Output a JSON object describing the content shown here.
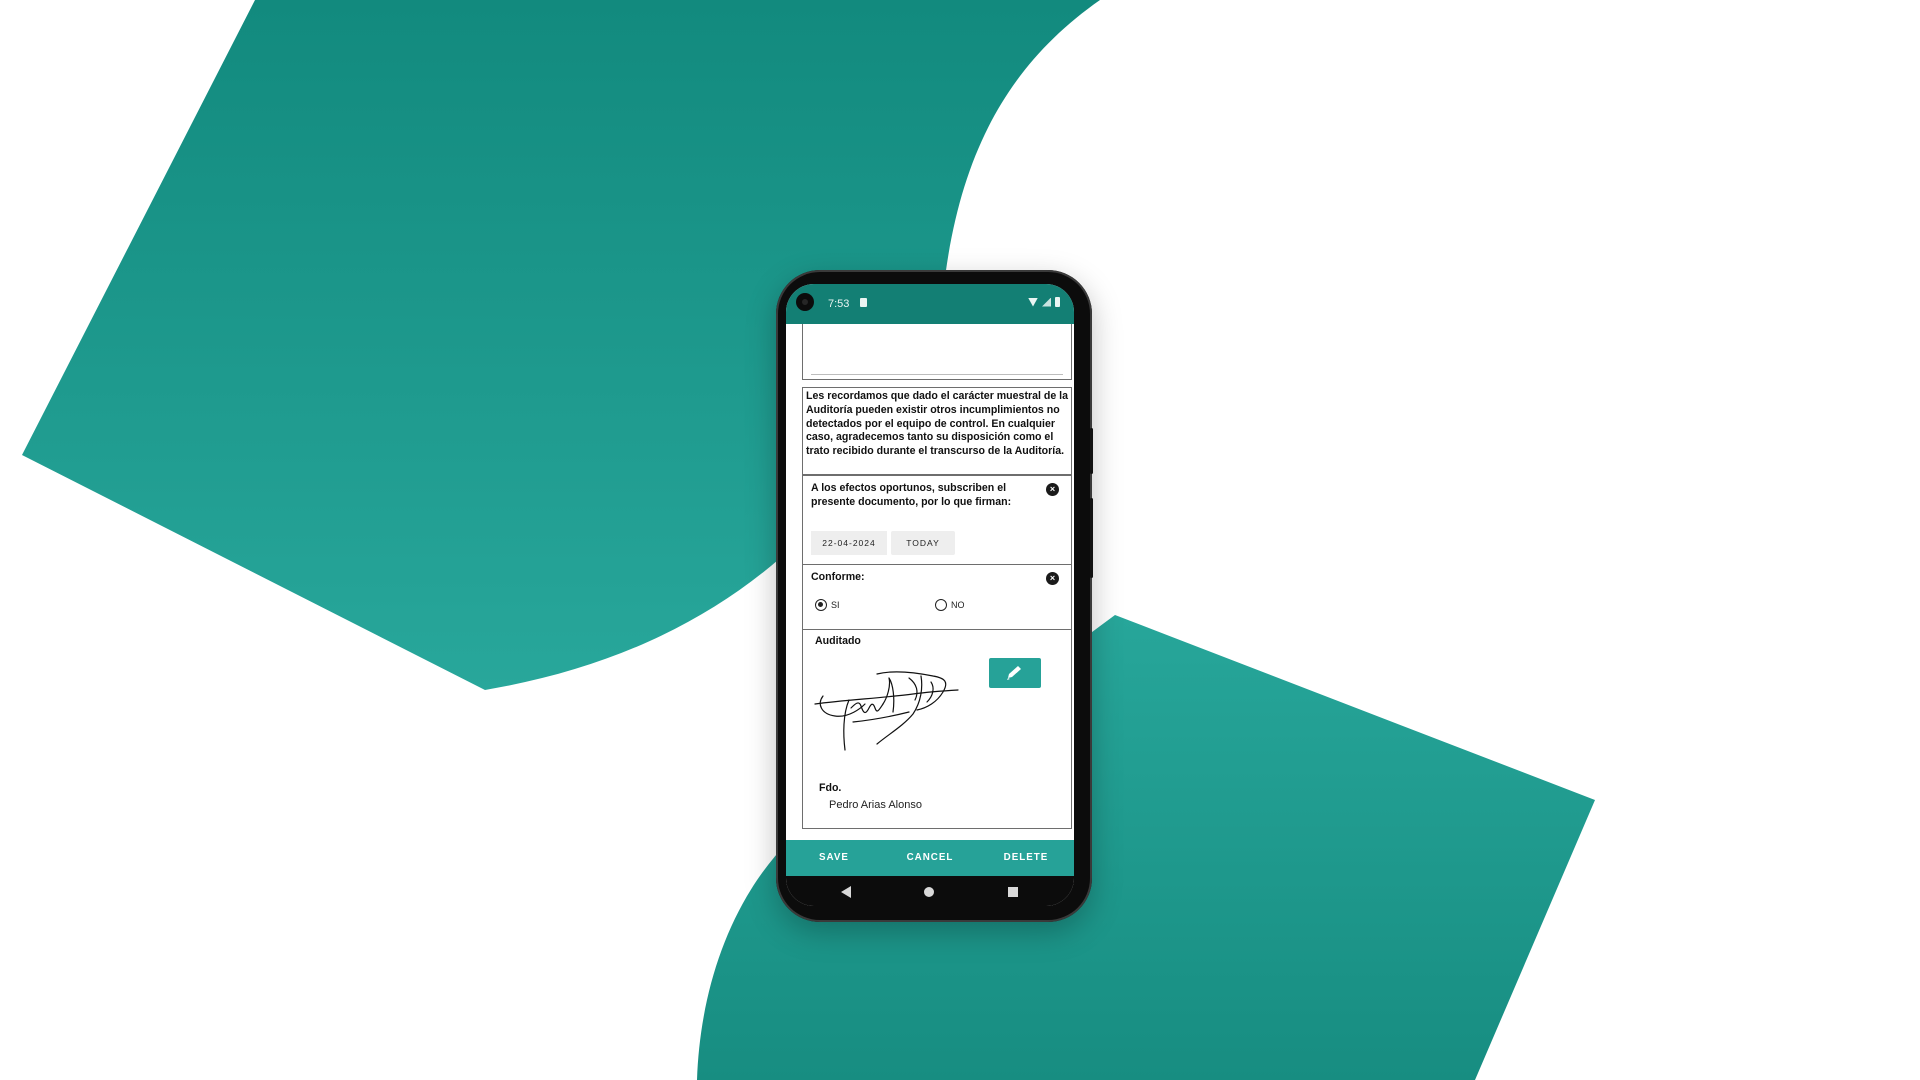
{
  "colors": {
    "teal": "#26a298",
    "teal_dark": "#137f74",
    "phone_body": "#0c0c0c"
  },
  "status_bar": {
    "time": "7:53",
    "icons": [
      "sd-card-icon",
      "wifi-icon",
      "signal-icon",
      "battery-icon"
    ]
  },
  "form": {
    "notice_text": "Les recordamos que dado el carácter muestral de la Auditoría pueden existir otros incumplimientos no detectados por el equipo de control. En cualquier caso, agradecemos tanto su disposición como el trato recibido durante el transcurso de la Auditoría.",
    "signature_question": {
      "text": "A los efectos oportunos, subscriben el presente documento, por lo que firman:",
      "date": "22-04-2024",
      "today_label": "TODAY",
      "clear_icon": "close-circle-icon"
    },
    "conforme": {
      "label": "Conforme:",
      "options": [
        {
          "label": "SI",
          "selected": true
        },
        {
          "label": "NO",
          "selected": false
        }
      ],
      "clear_icon": "close-circle-icon"
    },
    "auditado": {
      "label": "Auditado",
      "edit_icon": "pencil-icon",
      "fdo_label": "Fdo.",
      "signer_name": "Pedro Arias Alonso"
    }
  },
  "actions": {
    "save": "SAVE",
    "cancel": "CANCEL",
    "delete": "DELETE"
  },
  "nav": {
    "icons": [
      "back-icon",
      "home-icon",
      "recents-icon"
    ]
  }
}
